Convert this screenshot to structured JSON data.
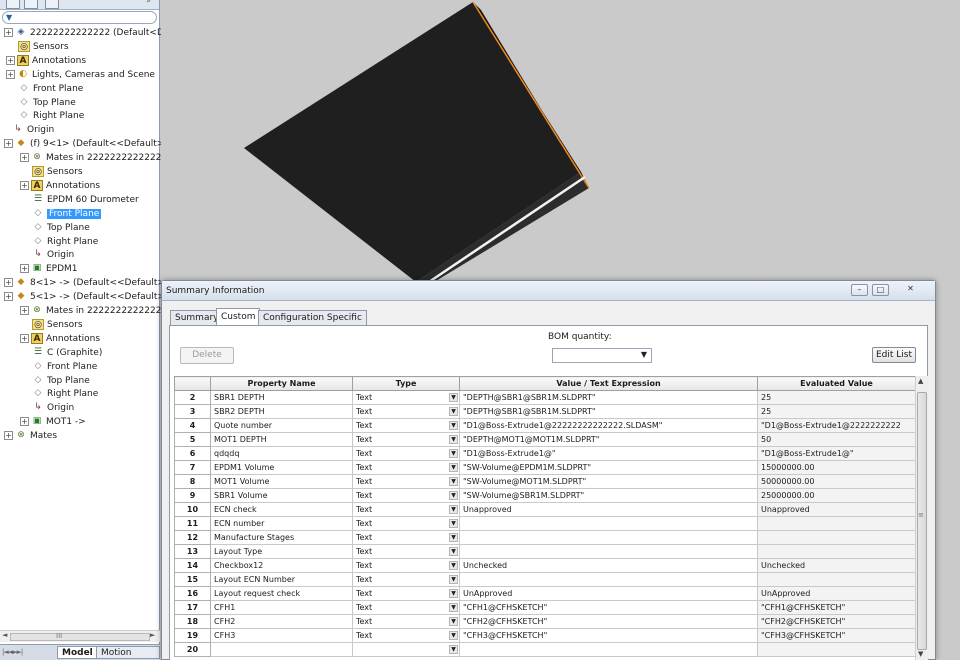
{
  "feature_tree": {
    "nodes": [
      {
        "label": "22222222222222  (Default<Disp",
        "icon": "assembly-icon"
      },
      {
        "label": "Sensors",
        "icon": "sensors-icon"
      },
      {
        "label": "Annotations",
        "icon": "annotations-icon"
      },
      {
        "label": "Lights, Cameras and Scene",
        "icon": "lights-icon"
      },
      {
        "label": "Front Plane",
        "icon": "plane-icon"
      },
      {
        "label": "Top Plane",
        "icon": "plane-icon"
      },
      {
        "label": "Right Plane",
        "icon": "plane-icon"
      },
      {
        "label": "Origin",
        "icon": "origin-icon"
      },
      {
        "label": "(f) 9<1> (Default<<Default>_[",
        "icon": "part-icon"
      },
      {
        "label": "Mates in 22222222222222",
        "icon": "mates-icon"
      },
      {
        "label": "Sensors",
        "icon": "sensors-icon"
      },
      {
        "label": "Annotations",
        "icon": "annotations-icon"
      },
      {
        "label": "EPDM 60 Durometer",
        "icon": "material-icon"
      },
      {
        "label": "Front Plane",
        "icon": "plane-icon"
      },
      {
        "label": "Top Plane",
        "icon": "plane-icon"
      },
      {
        "label": "Right Plane",
        "icon": "plane-icon"
      },
      {
        "label": "Origin",
        "icon": "origin-icon"
      },
      {
        "label": "EPDM1",
        "icon": "body-icon"
      },
      {
        "label": "8<1> -> (Default<<Default>_[",
        "icon": "part-icon"
      },
      {
        "label": "5<1> -> (Default<<Default>_[",
        "icon": "part-icon"
      },
      {
        "label": "Mates in 22222222222222",
        "icon": "mates-icon"
      },
      {
        "label": "Sensors",
        "icon": "sensors-icon"
      },
      {
        "label": "Annotations",
        "icon": "annotations-icon"
      },
      {
        "label": "C (Graphite)",
        "icon": "material-icon"
      },
      {
        "label": "Front Plane",
        "icon": "plane-icon"
      },
      {
        "label": "Top Plane",
        "icon": "plane-icon"
      },
      {
        "label": "Right Plane",
        "icon": "plane-icon"
      },
      {
        "label": "Origin",
        "icon": "origin-icon"
      },
      {
        "label": "MOT1 ->",
        "icon": "body-icon"
      },
      {
        "label": "Mates",
        "icon": "mates-icon"
      }
    ],
    "hscroll_glyph": "III"
  },
  "bottom_tabs": {
    "model": "Model",
    "motion_study": "Motion Study"
  },
  "dialog": {
    "title": "Summary Information",
    "tabs": [
      "Summary",
      "Custom",
      "Configuration Specific"
    ],
    "active_tab": "Custom",
    "delete_label": "Delete",
    "bom_label": "BOM quantity:",
    "bom_value": "",
    "edit_list_label": "Edit List",
    "columns": [
      "Property Name",
      "Type",
      "Value / Text Expression",
      "Evaluated Value"
    ],
    "rows": [
      {
        "n": "2",
        "name": "SBR1 DEPTH",
        "type": "Text",
        "value": "\"DEPTH@SBR1@SBR1M.SLDPRT\"",
        "evaluated": "25"
      },
      {
        "n": "3",
        "name": "SBR2 DEPTH",
        "type": "Text",
        "value": "\"DEPTH@SBR1@SBR1M.SLDPRT\"",
        "evaluated": "25"
      },
      {
        "n": "4",
        "name": "Quote number",
        "type": "Text",
        "value": "\"D1@Boss-Extrude1@22222222222222.SLDASM\"",
        "evaluated": "\"D1@Boss-Extrude1@2222222222"
      },
      {
        "n": "5",
        "name": "MOT1 DEPTH",
        "type": "Text",
        "value": "\"DEPTH@MOT1@MOT1M.SLDPRT\"",
        "evaluated": "50"
      },
      {
        "n": "6",
        "name": "qdqdq",
        "type": "Text",
        "value": "\"D1@Boss-Extrude1@\"",
        "evaluated": "\"D1@Boss-Extrude1@\""
      },
      {
        "n": "7",
        "name": "EPDM1 Volume",
        "type": "Text",
        "value": "\"SW-Volume@EPDM1M.SLDPRT\"",
        "evaluated": "15000000.00"
      },
      {
        "n": "8",
        "name": "MOT1 Volume",
        "type": "Text",
        "value": "\"SW-Volume@MOT1M.SLDPRT\"",
        "evaluated": "50000000.00"
      },
      {
        "n": "9",
        "name": "SBR1 Volume",
        "type": "Text",
        "value": "\"SW-Volume@SBR1M.SLDPRT\"",
        "evaluated": "25000000.00"
      },
      {
        "n": "10",
        "name": "ECN check",
        "type": "Text",
        "value": "Unapproved",
        "evaluated": "Unapproved"
      },
      {
        "n": "11",
        "name": "ECN number",
        "type": "Text",
        "value": "",
        "evaluated": ""
      },
      {
        "n": "12",
        "name": "Manufacture Stages",
        "type": "Text",
        "value": "",
        "evaluated": ""
      },
      {
        "n": "13",
        "name": "Layout Type",
        "type": "Text",
        "value": "",
        "evaluated": ""
      },
      {
        "n": "14",
        "name": "Checkbox12",
        "type": "Text",
        "value": "Unchecked",
        "evaluated": "Unchecked"
      },
      {
        "n": "15",
        "name": "Layout ECN Number",
        "type": "Text",
        "value": "",
        "evaluated": ""
      },
      {
        "n": "16",
        "name": "Layout request check",
        "type": "Text",
        "value": "UnApproved",
        "evaluated": "UnApproved"
      },
      {
        "n": "17",
        "name": "CFH1",
        "type": "Text",
        "value": "\"CFH1@CFHSKETCH\"",
        "evaluated": "\"CFH1@CFHSKETCH\""
      },
      {
        "n": "18",
        "name": "CFH2",
        "type": "Text",
        "value": "\"CFH2@CFHSKETCH\"",
        "evaluated": "\"CFH2@CFHSKETCH\""
      },
      {
        "n": "19",
        "name": "CFH3",
        "type": "Text",
        "value": "\"CFH3@CFHSKETCH\"",
        "evaluated": "\"CFH3@CFHSKETCH\""
      },
      {
        "n": "20",
        "name": "",
        "type": "",
        "value": "",
        "evaluated": ""
      }
    ]
  },
  "colors": {
    "selection": "#3399ff",
    "model_face": "#1e1e1e",
    "model_edge_highlight": "#f08a1c"
  }
}
